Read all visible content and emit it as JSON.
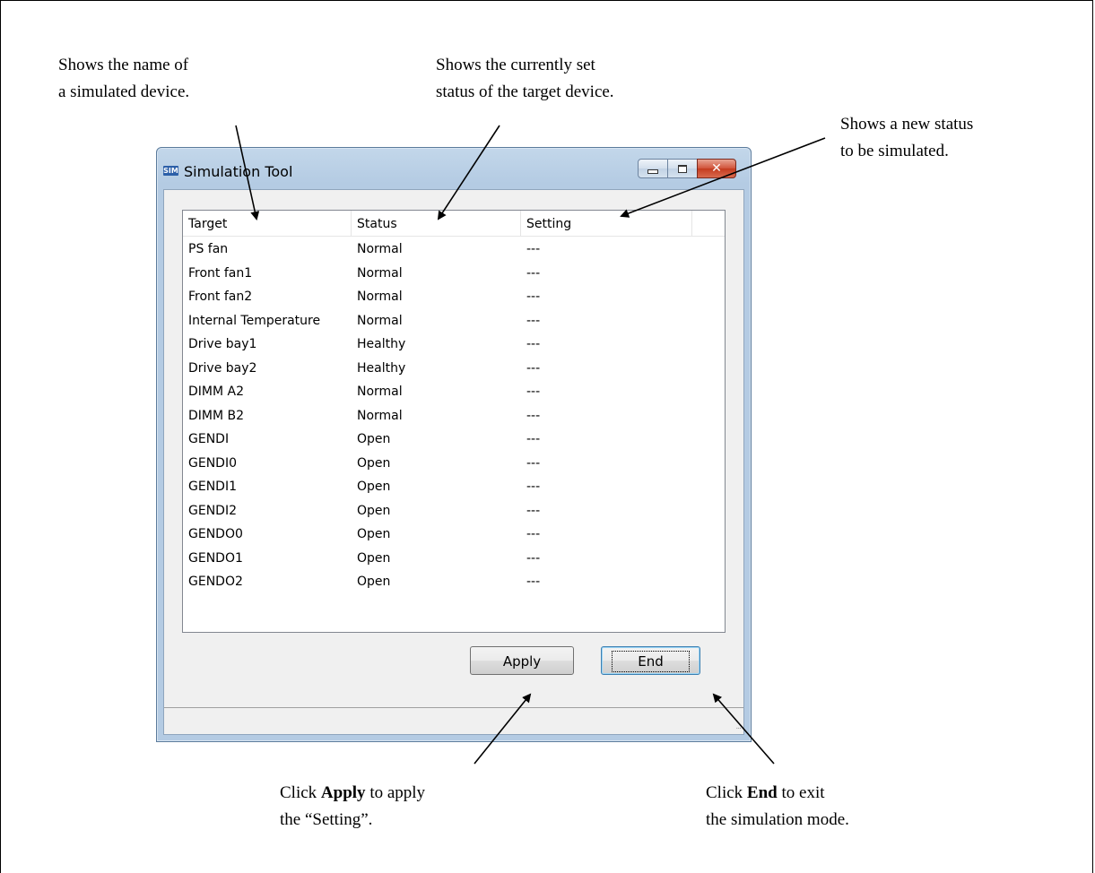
{
  "callouts": {
    "target_name": [
      "Shows the name of",
      "a simulated device."
    ],
    "current_status": [
      "Shows the currently set",
      "status of the target device."
    ],
    "new_status": [
      "Shows a new status",
      "to be simulated."
    ],
    "apply": {
      "pre": "Click ",
      "bold": "Apply",
      "post": " to apply",
      "line2": "the “Setting”."
    },
    "end": {
      "pre": "Click ",
      "bold": "End",
      "post": " to exit",
      "line2": "the simulation mode."
    }
  },
  "window": {
    "icon_text": "SIM",
    "title": "Simulation Tool",
    "controls": {
      "minimize_icon": "minimize-icon",
      "maximize_icon": "maximize-icon",
      "close_icon": "close-icon",
      "close_glyph": "✕"
    }
  },
  "list": {
    "columns": [
      "Target",
      "Status",
      "Setting"
    ],
    "rows": [
      [
        "PS fan",
        "Normal",
        "---"
      ],
      [
        "Front fan1",
        "Normal",
        "---"
      ],
      [
        "Front fan2",
        "Normal",
        "---"
      ],
      [
        "Internal Temperature",
        "Normal",
        "---"
      ],
      [
        "Drive bay1",
        "Healthy",
        "---"
      ],
      [
        "Drive bay2",
        "Healthy",
        "---"
      ],
      [
        "DIMM A2",
        "Normal",
        "---"
      ],
      [
        "DIMM B2",
        "Normal",
        "---"
      ],
      [
        "GENDI",
        "Open",
        "---"
      ],
      [
        "GENDI0",
        "Open",
        "---"
      ],
      [
        "GENDI1",
        "Open",
        "---"
      ],
      [
        "GENDI2",
        "Open",
        "---"
      ],
      [
        "GENDO0",
        "Open",
        "---"
      ],
      [
        "GENDO1",
        "Open",
        "---"
      ],
      [
        "GENDO2",
        "Open",
        "---"
      ]
    ]
  },
  "buttons": {
    "apply": "Apply",
    "end": "End"
  },
  "statusbar": {
    "grip": "..."
  }
}
